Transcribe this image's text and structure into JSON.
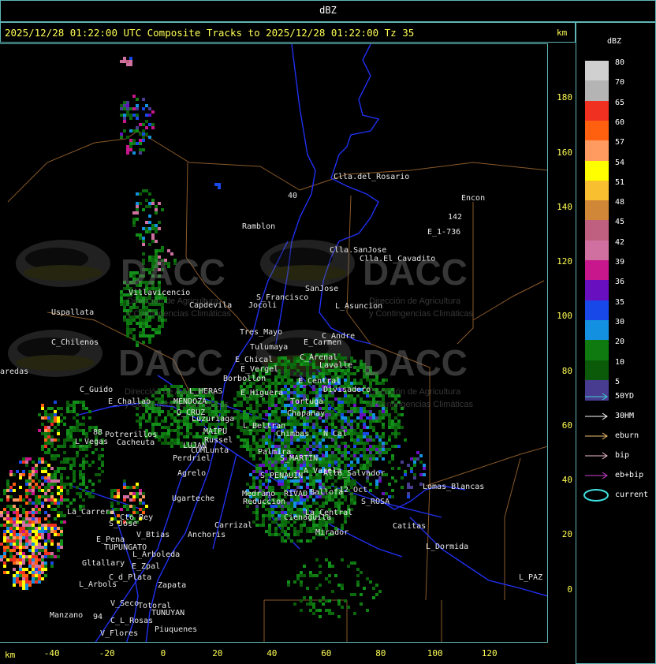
{
  "header": {
    "title": "dBZ"
  },
  "info": {
    "text": "2025/12/28 01:22:00 UTC Composite Tracks to 2025/12/28 01:22:00 Tz 35",
    "km": "km"
  },
  "axes": {
    "x_unit": "km",
    "x_ticks": [
      "-40",
      "-20",
      "0",
      "20",
      "40",
      "60",
      "80",
      "100",
      "120"
    ],
    "y_ticks": [
      "180",
      "160",
      "140",
      "120",
      "100",
      "80",
      "60",
      "40",
      "20",
      "0"
    ]
  },
  "legend": {
    "title": "dBZ",
    "scale": [
      {
        "label": "80",
        "color": "#d0d0d0"
      },
      {
        "label": "70",
        "color": "#b4b4b4"
      },
      {
        "label": "65",
        "color": "#f03020"
      },
      {
        "label": "60",
        "color": "#ff6010"
      },
      {
        "label": "57",
        "color": "#ff9a60"
      },
      {
        "label": "54",
        "color": "#ffff00"
      },
      {
        "label": "51",
        "color": "#f8c030"
      },
      {
        "label": "48",
        "color": "#d08838"
      },
      {
        "label": "45",
        "color": "#c06080"
      },
      {
        "label": "42",
        "color": "#d070a0"
      },
      {
        "label": "39",
        "color": "#c8168c"
      },
      {
        "label": "36",
        "color": "#6810c0"
      },
      {
        "label": "35",
        "color": "#1848e8"
      },
      {
        "label": "30",
        "color": "#1490e0"
      },
      {
        "label": "20",
        "color": "#0e7a10"
      },
      {
        "label": "10",
        "color": "#0a5a0a"
      },
      {
        "label": "5",
        "color": "#483c90"
      }
    ],
    "tracks": [
      {
        "label": "50YD",
        "color": "#40d0d0",
        "type": "arrow"
      },
      {
        "label": "30HM",
        "color": "#ffffff",
        "type": "arrow"
      },
      {
        "label": "eburn",
        "color": "#f0c070",
        "type": "arrow"
      },
      {
        "label": "bip",
        "color": "#f0c0d0",
        "type": "arrow"
      },
      {
        "label": "eb+bip",
        "color": "#d040d0",
        "type": "arrow"
      },
      {
        "label": "current",
        "color": "#40e0e0",
        "type": "ellipse"
      }
    ]
  },
  "watermark": {
    "brand": "DACC",
    "line1": "Dirección de Agricultura",
    "line2": "y Contingencias Climáticas"
  },
  "places": [
    {
      "name": "Clla.del_Rosario"
    },
    {
      "name": "Encon"
    },
    {
      "name": "142"
    },
    {
      "name": "E_1-736"
    },
    {
      "name": "Ramblon"
    },
    {
      "name": "Clla.SanJose"
    },
    {
      "name": "Clla.El_Cavadito"
    },
    {
      "name": "Villavicencio"
    },
    {
      "name": "Capdevila"
    },
    {
      "name": "S_Francisco"
    },
    {
      "name": "Jocoli"
    },
    {
      "name": "SanJose"
    },
    {
      "name": "L_Asuncion"
    },
    {
      "name": "Uspallata"
    },
    {
      "name": "Tres_Mayo"
    },
    {
      "name": "C_Andre"
    },
    {
      "name": "E_Carmen"
    },
    {
      "name": "C_Chilenos"
    },
    {
      "name": "Tulumaya"
    },
    {
      "name": "E_Chical"
    },
    {
      "name": "C_Arenal"
    },
    {
      "name": "E_Vergel"
    },
    {
      "name": "Lavalle"
    },
    {
      "name": "aredas"
    },
    {
      "name": "Borbollon"
    },
    {
      "name": "E_Central"
    },
    {
      "name": "C_Guido"
    },
    {
      "name": "L_HERAS"
    },
    {
      "name": "E_Higuera"
    },
    {
      "name": "Divisadero"
    },
    {
      "name": "E_Challao"
    },
    {
      "name": "MENDOZA"
    },
    {
      "name": "Tortuga"
    },
    {
      "name": "G_CRUZ"
    },
    {
      "name": "Luzuriaga"
    },
    {
      "name": "Chapanay"
    },
    {
      "name": "L_Beltran"
    },
    {
      "name": "MAIPU"
    },
    {
      "name": "Russel"
    },
    {
      "name": "Chimbas"
    },
    {
      "name": "N_Cal"
    },
    {
      "name": "Potrerillos"
    },
    {
      "name": "L_Vegas"
    },
    {
      "name": "Cacheuta"
    },
    {
      "name": "LUJAN"
    },
    {
      "name": "CUMLunta"
    },
    {
      "name": "Palmira"
    },
    {
      "name": "Perdriel"
    },
    {
      "name": "S_MARTIN"
    },
    {
      "name": "Agrelo"
    },
    {
      "name": "S_PENAUIN"
    },
    {
      "name": "A_Varela"
    },
    {
      "name": "Alto_Salvador"
    },
    {
      "name": "Ugarteche"
    },
    {
      "name": "Medrano"
    },
    {
      "name": "RIVAD"
    },
    {
      "name": "Ballofa"
    },
    {
      "name": "Reduccion"
    },
    {
      "name": "12_Oct"
    },
    {
      "name": "Lomas_Blancas"
    },
    {
      "name": "La_Carrera"
    },
    {
      "name": "Cto_Rey"
    },
    {
      "name": "Carrizal"
    },
    {
      "name": "La_Central"
    },
    {
      "name": "S_ROSA"
    },
    {
      "name": "S_Jose"
    },
    {
      "name": "Cienaguita"
    },
    {
      "name": "Catitas"
    },
    {
      "name": "V_Btias"
    },
    {
      "name": "E_Pena"
    },
    {
      "name": "Anchoris"
    },
    {
      "name": "TUPUNGATO"
    },
    {
      "name": "Mirador"
    },
    {
      "name": "L_Arboleda"
    },
    {
      "name": "L_Dormida"
    },
    {
      "name": "Gltallary"
    },
    {
      "name": "E_Zpal"
    },
    {
      "name": "C_d_Plata"
    },
    {
      "name": "L_Arbols"
    },
    {
      "name": "Zapata"
    },
    {
      "name": "L_PAZ"
    },
    {
      "name": "V_Seco"
    },
    {
      "name": "Totoral"
    },
    {
      "name": "TUNUYAN"
    },
    {
      "name": "Manzano"
    },
    {
      "name": "C_L_Rosas"
    },
    {
      "name": "V_Flores"
    },
    {
      "name": "Piuquenes"
    },
    {
      "name": "40"
    },
    {
      "name": "88"
    },
    {
      "name": "94"
    }
  ]
}
